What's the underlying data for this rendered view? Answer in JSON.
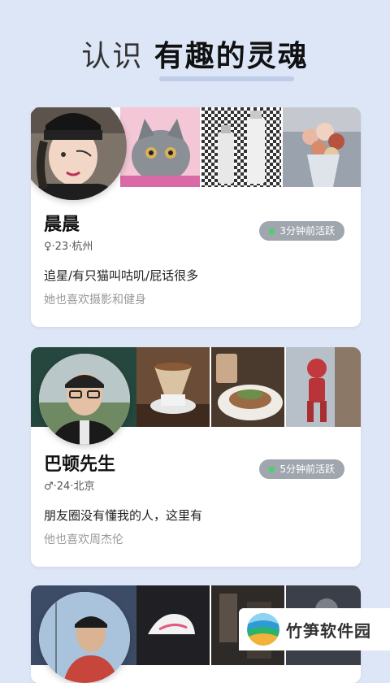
{
  "header": {
    "title_prefix": "认识",
    "title_emphasis": "有趣的灵魂"
  },
  "profiles": [
    {
      "name": "晨晨",
      "meta": "♀·23·杭州",
      "active": "3分钟前活跃",
      "bio": "追星/有只猫叫咕叽/屁话很多",
      "likes": "她也喜欢摄影和健身"
    },
    {
      "name": "巴顿先生",
      "meta": "♂·24·北京",
      "active": "5分钟前活跃",
      "bio": "朋友圈没有懂我的人，这里有",
      "likes": "他也喜欢周杰伦"
    }
  ],
  "watermark": {
    "text": "竹笋软件园"
  },
  "colors": {
    "background": "#dde6f7",
    "active_dot": "#46d46a",
    "badge": "#9fa6ad"
  }
}
